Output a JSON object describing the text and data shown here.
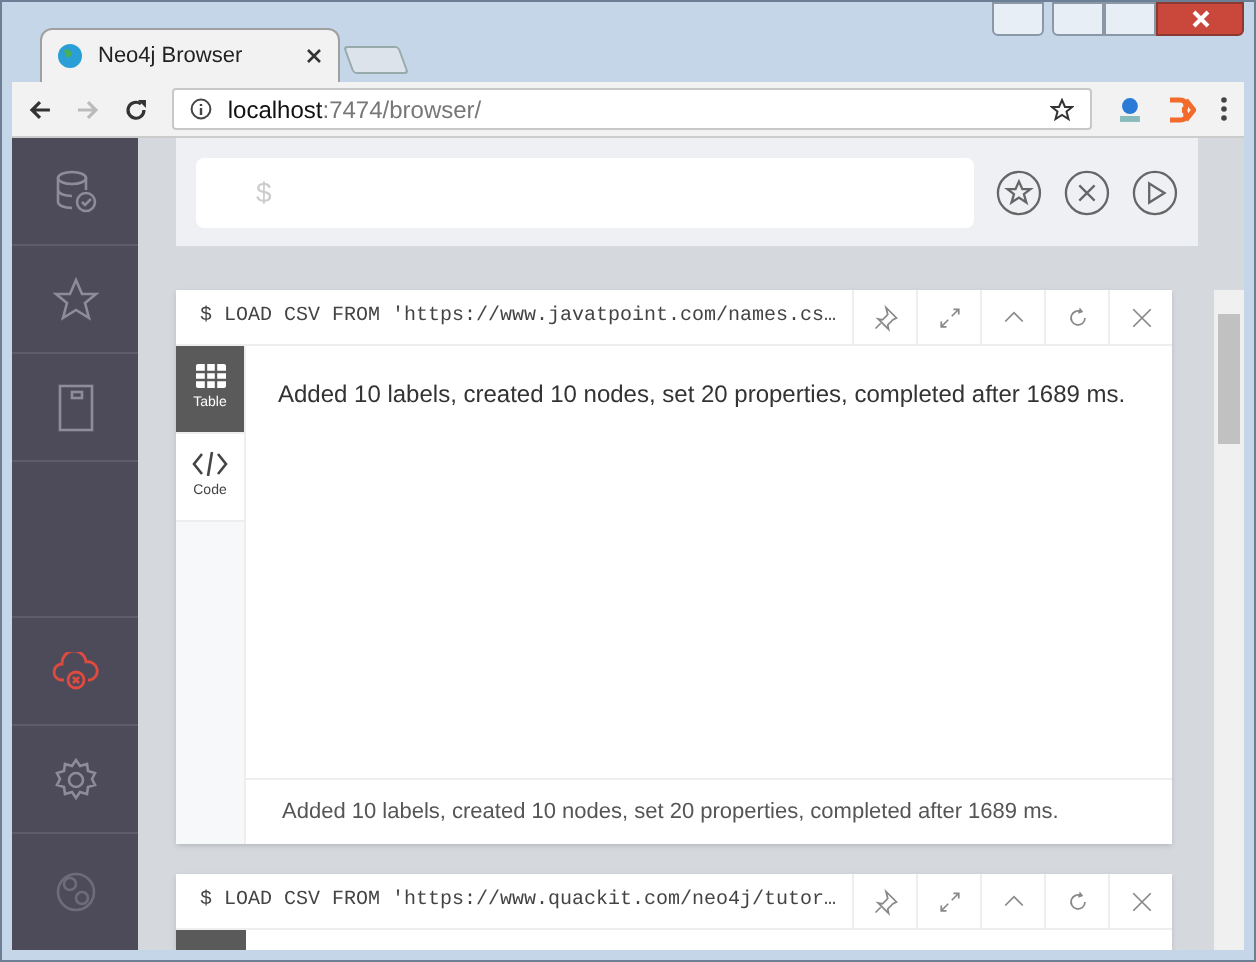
{
  "browser": {
    "tab_title": "Neo4j Browser",
    "address_host": "localhost",
    "address_path": ":7474/browser/"
  },
  "editor": {
    "placeholder": "$"
  },
  "frames": [
    {
      "command": "$ LOAD CSV FROM 'https://www.javatpoint.com/names.cs…",
      "tabs": [
        {
          "label": "Table",
          "selected": true
        },
        {
          "label": "Code",
          "selected": false
        }
      ],
      "message": "Added 10 labels, created 10 nodes, set 20 properties, completed after 1689 ms.",
      "status": "Added 10 labels, created 10 nodes, set 20 properties, completed after 1689 ms."
    },
    {
      "command": "$ LOAD CSV FROM 'https://www.quackit.com/neo4j/tutor…"
    }
  ]
}
